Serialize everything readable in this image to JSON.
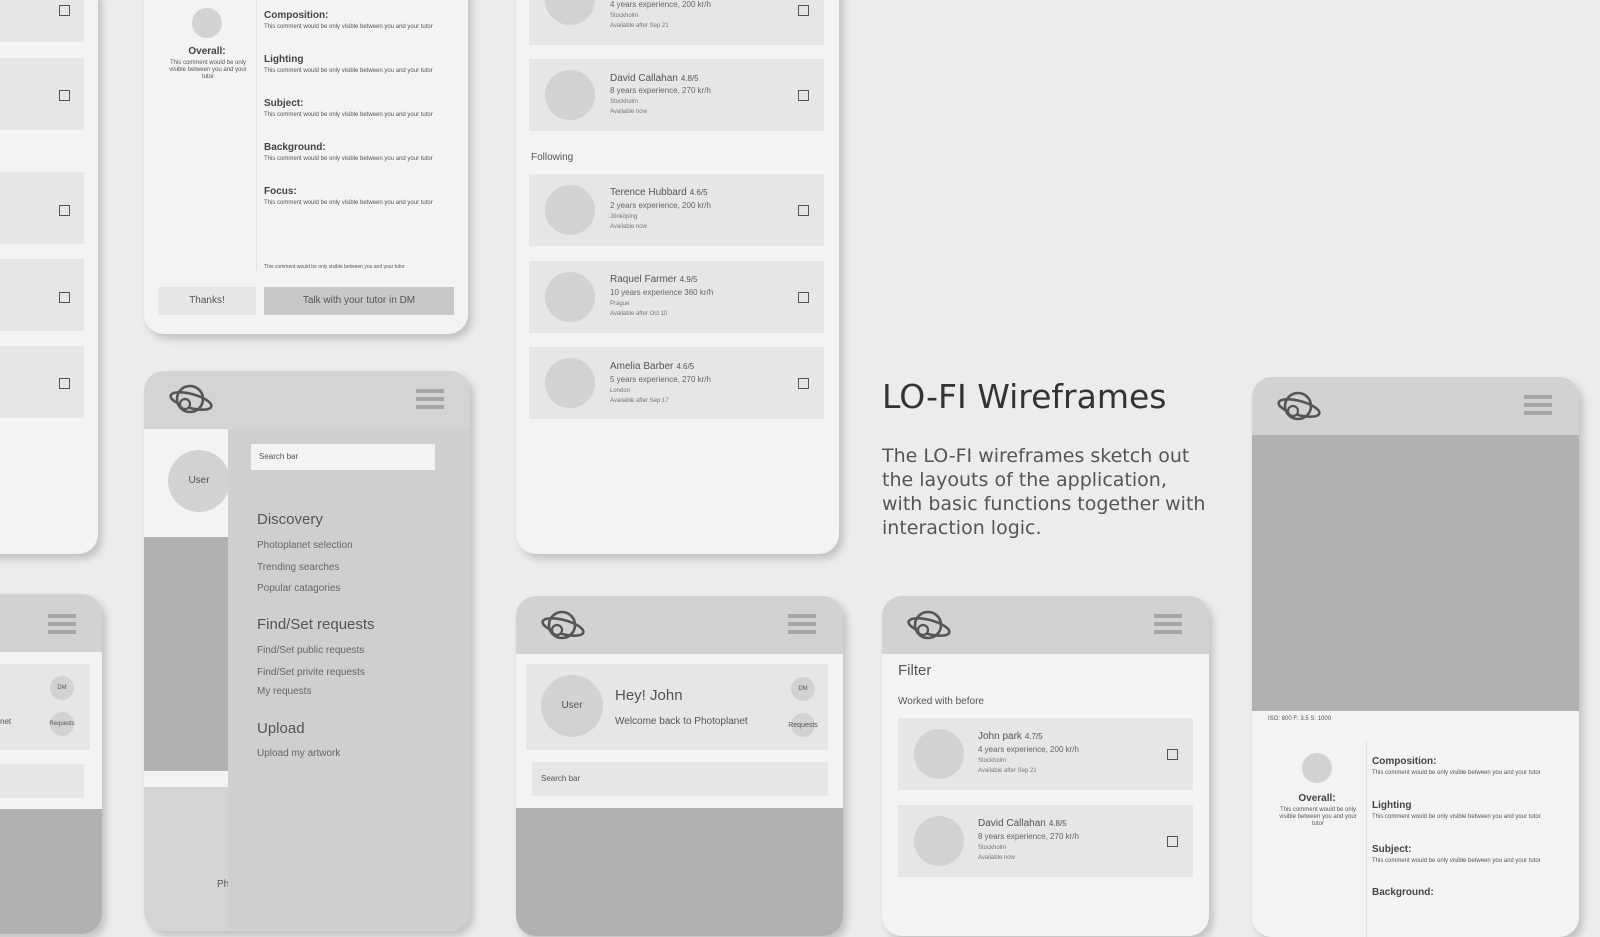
{
  "heading": "LO-FI Wireframes",
  "description": "The LO-FI wireframes sketch out the layouts of the application, with basic functions together with interaction logic.",
  "critique": {
    "overall_title": "Overall:",
    "overall_comment": "This comment would be only visible between you and your tutor",
    "items": [
      {
        "title": "Composition:",
        "comment": "This comment would be only visible between you and your tutor"
      },
      {
        "title": "Lighting",
        "comment": "This comment would be only visible between you and your tutor"
      },
      {
        "title": "Subject:",
        "comment": "This comment would be only visible between you and your tutor"
      },
      {
        "title": "Background:",
        "comment": "This comment would be only visible between you and your tutor"
      },
      {
        "title": "Focus:",
        "comment": "This comment would be only visible between you and your tutor"
      }
    ],
    "footer_note": "This comment would be only visible between you and your tutor",
    "thanks_button": "Thanks!",
    "dm_button": "Talk with your tutor in DM"
  },
  "menu": {
    "user_avatar": "User",
    "search_placeholder": "Search bar",
    "discovery": "Discovery",
    "discovery_items": [
      "Photoplanet selection",
      "Trending searches",
      "Popular catagories"
    ],
    "requests": "Find/Set requests",
    "requests_items": [
      "Find/Set public requests",
      "Find/Set privite requests",
      "My requests"
    ],
    "upload": "Upload",
    "upload_items": [
      "Upload my artwork"
    ],
    "peek_text": "Ph"
  },
  "tutors": {
    "partial_exp": "4 years experience, 200 kr/h",
    "partial_city": "Stockholm",
    "partial_avail": "Available after Sep 21",
    "following_label": "Following",
    "top": {
      "name": "David Callahan",
      "rating": "4.8/5",
      "exp": "8 years experience, 270 kr/h",
      "city": "Stockholm",
      "avail": "Available now"
    },
    "following": [
      {
        "name": "Terence Hubbard",
        "rating": "4.6/5",
        "exp": "2 years experience, 200 kr/h",
        "city": "Jönköping",
        "avail": "Available now"
      },
      {
        "name": "Raquel Farmer",
        "rating": "4.9/5",
        "exp": "10 years experience 360 kr/h",
        "city": "Prague",
        "avail": "Available after Oct 10"
      },
      {
        "name": "Amelia Barber",
        "rating": "4.6/5",
        "exp": "5 years experience, 270 kr/h",
        "city": "London",
        "avail": "Available after Sep 17"
      }
    ]
  },
  "home": {
    "user_avatar": "User",
    "greeting": "Hey! John",
    "welcome": "Welcome back to Photoplanet",
    "dm": "DM",
    "requests": "Requests",
    "search_placeholder": "Search bar"
  },
  "left_home": {
    "dm": "DM",
    "requests": "Requests",
    "partial_text": "net"
  },
  "filter": {
    "title": "Filter",
    "section": "Worked with before",
    "people": [
      {
        "name": "John park",
        "rating": "4.7/5",
        "exp": "4 years experience, 200 kr/h",
        "city": "Stockholm",
        "avail": "Available after Sep 21"
      },
      {
        "name": "David Callahan",
        "rating": "4.8/5",
        "exp": "8 years experience, 270 kr/h",
        "city": "Stockholm",
        "avail": "Available now"
      }
    ]
  },
  "photo": {
    "exif": "ISO: 800   F: 3.5   S: 1000",
    "overall_title": "Overall:",
    "overall_comment": "This comment would be only visible between you and your tutor",
    "items": [
      {
        "title": "Composition:",
        "comment": "This comment would be only visible between you and your tutor"
      },
      {
        "title": "Lighting",
        "comment": "This comment would be only visible between you and your tutor"
      },
      {
        "title": "Subject:",
        "comment": "This comment would be only visible between you and your tutor"
      },
      {
        "title": "Background:",
        "comment": ""
      }
    ]
  },
  "icons": {
    "logo": "planet-logo-icon",
    "menu": "hamburger-menu-icon",
    "checkbox": "checkbox-icon"
  }
}
